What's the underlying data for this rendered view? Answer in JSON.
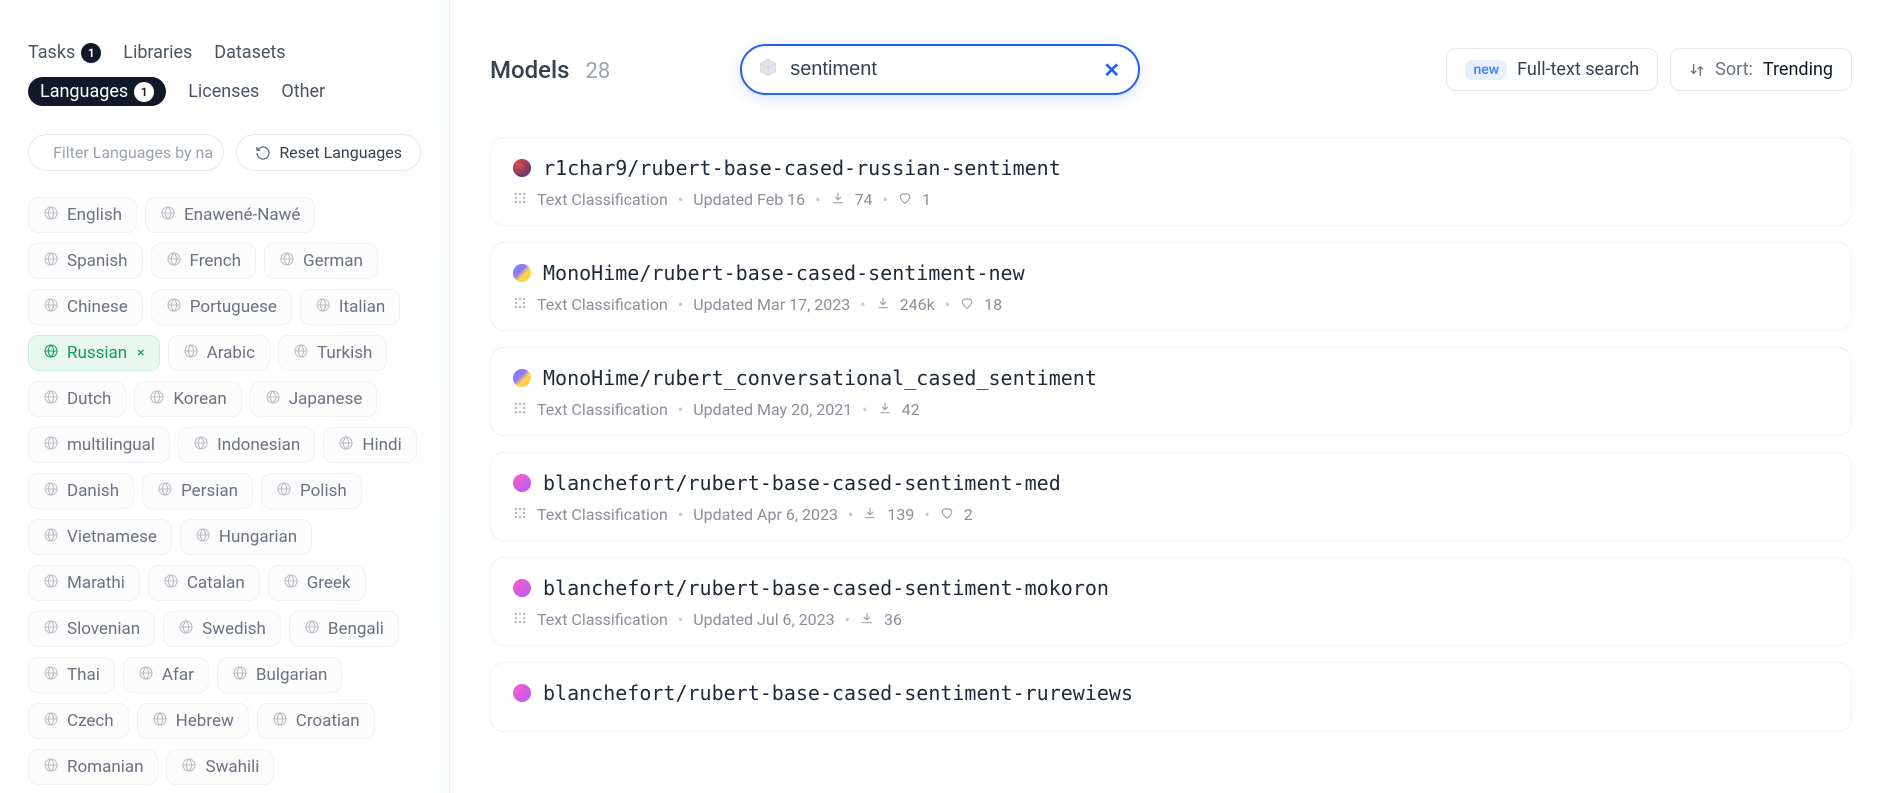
{
  "sidebar": {
    "tabs": [
      {
        "label": "Tasks",
        "badge": "1",
        "active": false
      },
      {
        "label": "Libraries",
        "badge": null,
        "active": false
      },
      {
        "label": "Datasets",
        "badge": null,
        "active": false
      },
      {
        "label": "Languages",
        "badge": "1",
        "active": true
      },
      {
        "label": "Licenses",
        "badge": null,
        "active": false
      },
      {
        "label": "Other",
        "badge": null,
        "active": false
      }
    ],
    "filter_placeholder": "Filter Languages by na",
    "reset_label": "Reset Languages",
    "languages": [
      {
        "name": "English",
        "selected": false
      },
      {
        "name": "Enawené-Nawé",
        "selected": false
      },
      {
        "name": "Spanish",
        "selected": false
      },
      {
        "name": "French",
        "selected": false
      },
      {
        "name": "German",
        "selected": false
      },
      {
        "name": "Chinese",
        "selected": false
      },
      {
        "name": "Portuguese",
        "selected": false
      },
      {
        "name": "Italian",
        "selected": false
      },
      {
        "name": "Russian",
        "selected": true
      },
      {
        "name": "Arabic",
        "selected": false
      },
      {
        "name": "Turkish",
        "selected": false
      },
      {
        "name": "Dutch",
        "selected": false
      },
      {
        "name": "Korean",
        "selected": false
      },
      {
        "name": "Japanese",
        "selected": false
      },
      {
        "name": "multilingual",
        "selected": false
      },
      {
        "name": "Indonesian",
        "selected": false
      },
      {
        "name": "Hindi",
        "selected": false
      },
      {
        "name": "Danish",
        "selected": false
      },
      {
        "name": "Persian",
        "selected": false
      },
      {
        "name": "Polish",
        "selected": false
      },
      {
        "name": "Vietnamese",
        "selected": false
      },
      {
        "name": "Hungarian",
        "selected": false
      },
      {
        "name": "Marathi",
        "selected": false
      },
      {
        "name": "Catalan",
        "selected": false
      },
      {
        "name": "Greek",
        "selected": false
      },
      {
        "name": "Slovenian",
        "selected": false
      },
      {
        "name": "Swedish",
        "selected": false
      },
      {
        "name": "Bengali",
        "selected": false
      },
      {
        "name": "Thai",
        "selected": false
      },
      {
        "name": "Afar",
        "selected": false
      },
      {
        "name": "Bulgarian",
        "selected": false
      },
      {
        "name": "Czech",
        "selected": false
      },
      {
        "name": "Hebrew",
        "selected": false
      },
      {
        "name": "Croatian",
        "selected": false
      },
      {
        "name": "Romanian",
        "selected": false
      },
      {
        "name": "Swahili",
        "selected": false
      }
    ]
  },
  "topbar": {
    "heading": "Models",
    "count": "28",
    "search_value": "sentiment",
    "new_badge": "new",
    "fts_label": "Full-text search",
    "sort_label": "Sort:",
    "sort_value": "Trending"
  },
  "models": [
    {
      "name": "r1char9/rubert-base-cased-russian-sentiment",
      "task": "Text Classification",
      "updated": "Updated Feb 16",
      "downloads": "74",
      "likes": "1",
      "avatar_gradient": "radial-gradient(circle at 30% 30%, #e14b4b, #3b2f7a)"
    },
    {
      "name": "MonoHime/rubert-base-cased-sentiment-new",
      "task": "Text Classification",
      "updated": "Updated Mar 17, 2023",
      "downloads": "246k",
      "likes": "18",
      "avatar_gradient": "linear-gradient(135deg, #8a7bff 40%, #ffd24d 60%)"
    },
    {
      "name": "MonoHime/rubert_conversational_cased_sentiment",
      "task": "Text Classification",
      "updated": "Updated May 20, 2021",
      "downloads": "42",
      "likes": null,
      "avatar_gradient": "linear-gradient(135deg, #8a7bff 40%, #ffd24d 60%)"
    },
    {
      "name": "blanchefort/rubert-base-cased-sentiment-med",
      "task": "Text Classification",
      "updated": "Updated Apr 6, 2023",
      "downloads": "139",
      "likes": "2",
      "avatar_gradient": "linear-gradient(135deg, #ff5fbf, #b15bff)"
    },
    {
      "name": "blanchefort/rubert-base-cased-sentiment-mokoron",
      "task": "Text Classification",
      "updated": "Updated Jul 6, 2023",
      "downloads": "36",
      "likes": null,
      "avatar_gradient": "linear-gradient(135deg, #ff5fbf, #b15bff)"
    },
    {
      "name": "blanchefort/rubert-base-cased-sentiment-rurewiews",
      "task": null,
      "updated": null,
      "downloads": null,
      "likes": null,
      "avatar_gradient": "linear-gradient(135deg, #ff5fbf, #b15bff)"
    }
  ]
}
